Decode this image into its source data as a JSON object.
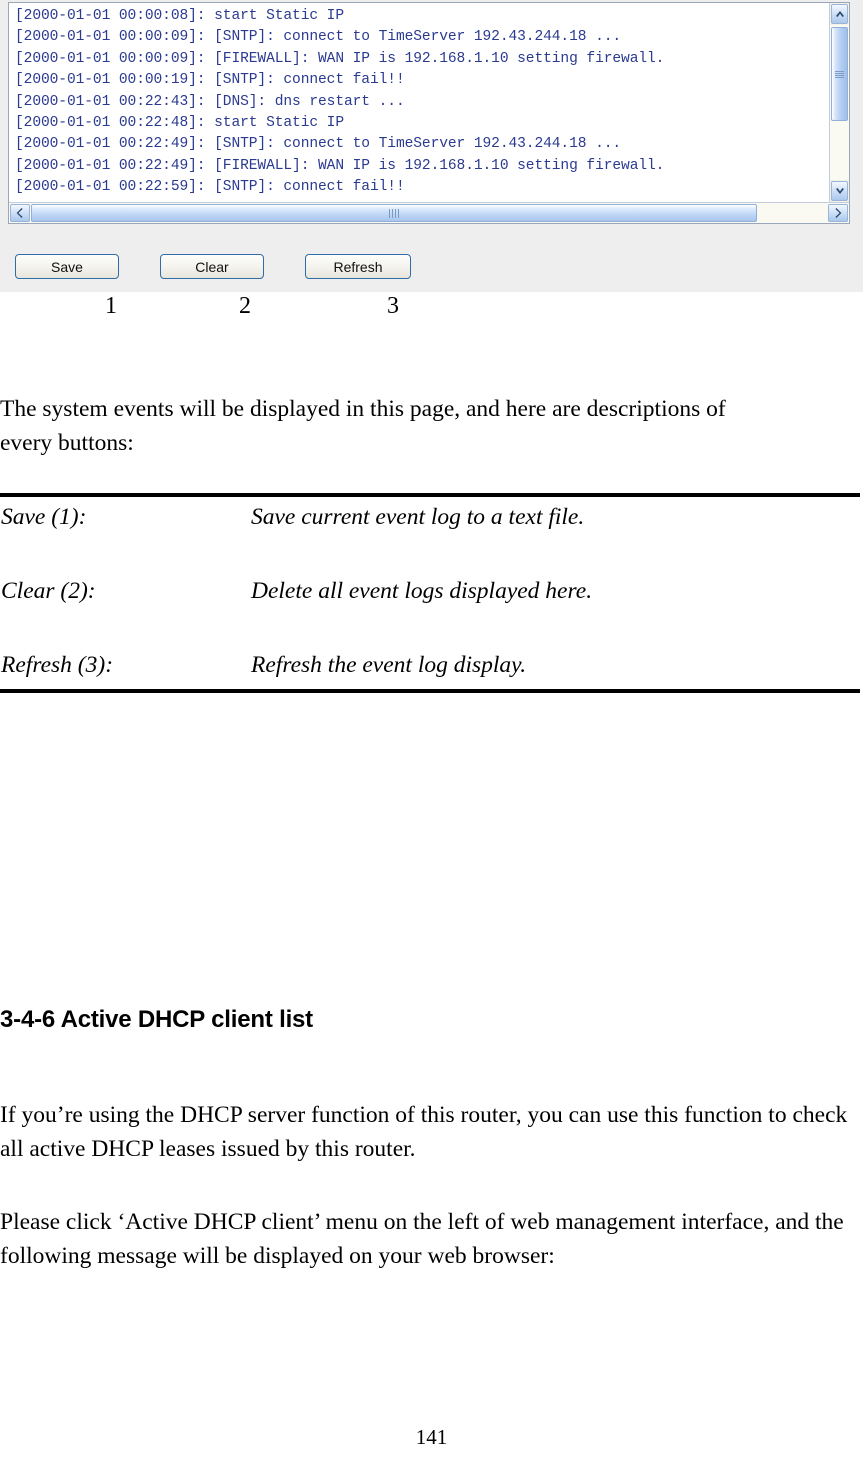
{
  "screenshot": {
    "log_lines": [
      "[2000-01-01 00:00:08]: start Static IP",
      "[2000-01-01 00:00:09]: [SNTP]: connect to TimeServer 192.43.244.18 ...",
      "[2000-01-01 00:00:09]: [FIREWALL]: WAN IP is 192.168.1.10 setting firewall.",
      "[2000-01-01 00:00:19]: [SNTP]: connect fail!!",
      "[2000-01-01 00:22:43]: [DNS]: dns restart ...",
      "[2000-01-01 00:22:48]: start Static IP",
      "[2000-01-01 00:22:49]: [SNTP]: connect to TimeServer 192.43.244.18 ...",
      "[2000-01-01 00:22:49]: [FIREWALL]: WAN IP is 192.168.1.10 setting firewall.",
      "[2000-01-01 00:22:59]: [SNTP]: connect fail!!"
    ],
    "log_text_color": "#2b3a91",
    "buttons": [
      {
        "label": "Save",
        "callout": "1"
      },
      {
        "label": "Clear",
        "callout": "2"
      },
      {
        "label": "Refresh",
        "callout": "3"
      }
    ],
    "scrollbars": {
      "vertical": {
        "up_icon": "chevron-up-icon",
        "down_icon": "chevron-down-icon"
      },
      "horizontal": {
        "left_icon": "chevron-left-icon",
        "right_icon": "chevron-right-icon"
      }
    }
  },
  "document": {
    "intro": "The system events will be displayed in this page, and here are descriptions of every buttons:",
    "descriptions": [
      {
        "term": "Save (1):",
        "definition": "Save current event log to a text file."
      },
      {
        "term": "Clear (2):",
        "definition": "Delete all event logs displayed here."
      },
      {
        "term": "Refresh (3):",
        "definition": "Refresh the event log display."
      }
    ],
    "section_heading": "3-4-6 Active DHCP client list",
    "body_paragraph_1": "If you’re using the DHCP server function of this router, you can use this function to check all active DHCP leases issued by this router.",
    "body_paragraph_2": "Please click ‘Active DHCP client’ menu on the left of web management interface, and the following message will be displayed on your web browser:",
    "page_number": "141"
  }
}
